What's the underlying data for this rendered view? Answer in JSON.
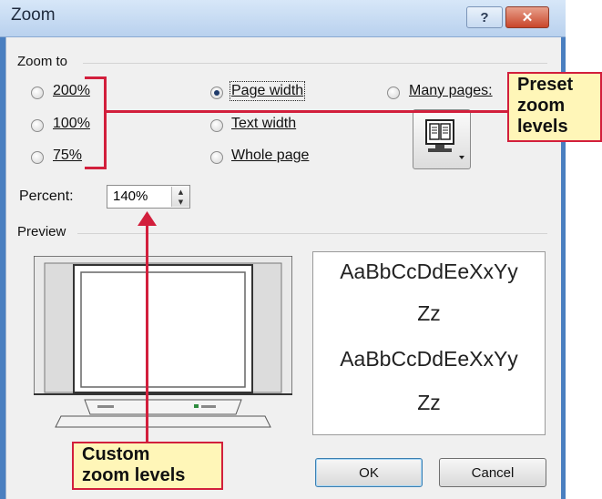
{
  "window": {
    "title": "Zoom",
    "help_glyph": "?",
    "close_glyph": "✕"
  },
  "zoom_to": {
    "group_label": "Zoom to",
    "options": [
      {
        "label": "200%",
        "checked": false
      },
      {
        "label": "100%",
        "checked": false
      },
      {
        "label": "75%",
        "checked": false
      },
      {
        "label": "Page width",
        "checked": true
      },
      {
        "label": "Text width",
        "checked": false
      },
      {
        "label": "Whole page",
        "checked": false
      },
      {
        "label": "Many pages:",
        "checked": false
      }
    ],
    "many_pages_icon": "monitor-pages-icon"
  },
  "percent": {
    "label": "Percent:",
    "value": "140%"
  },
  "preview": {
    "group_label": "Preview",
    "sample_lines": [
      "AaBbCcDdEeXxYy",
      "Zz",
      "AaBbCcDdEeXxYy",
      "Zz"
    ]
  },
  "buttons": {
    "ok": "OK",
    "cancel": "Cancel"
  },
  "callouts": {
    "preset": [
      "Preset",
      "zoom",
      "levels"
    ],
    "custom": [
      "Custom",
      "zoom levels"
    ]
  },
  "colors": {
    "callout_border": "#d21f3c",
    "callout_fill": "#fff6b8",
    "title_bar": "#c6dcf5"
  }
}
